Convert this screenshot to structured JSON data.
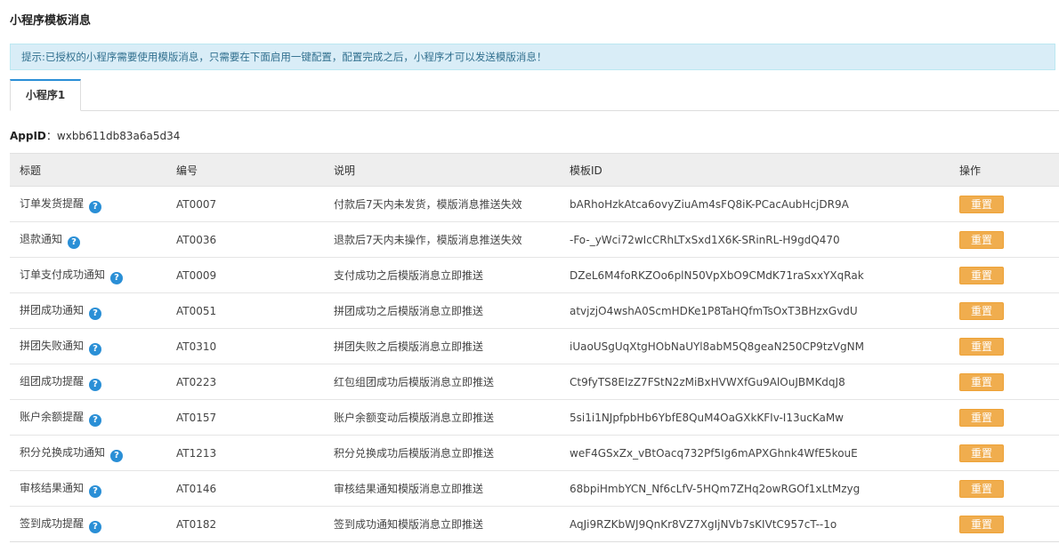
{
  "page_title": "小程序模板消息",
  "notice": "提示:已授权的小程序需要使用模版消息，只需要在下面启用一键配置，配置完成之后，小程序才可以发送模版消息！",
  "tabs": [
    {
      "label": "小程序1"
    }
  ],
  "appid": {
    "label": "AppID",
    "separator": "：",
    "value": "wxbb611db83a6a5d34"
  },
  "table": {
    "headers": [
      "标题",
      "编号",
      "说明",
      "模板ID",
      "操作"
    ],
    "help_icon": "?",
    "action_label": "重置",
    "rows": [
      {
        "title": "订单发货提醒",
        "code": "AT0007",
        "desc": "付款后7天内未发货，模版消息推送失效",
        "template_id": "bARhoHzkAtca6ovyZiuAm4sFQ8iK-PCacAubHcjDR9A"
      },
      {
        "title": "退款通知",
        "code": "AT0036",
        "desc": "退款后7天内未操作，模版消息推送失效",
        "template_id": "-Fo-_yWci72wIcCRhLTxSxd1X6K-SRinRL-H9gdQ470"
      },
      {
        "title": "订单支付成功通知",
        "code": "AT0009",
        "desc": "支付成功之后模版消息立即推送",
        "template_id": "DZeL6M4foRKZOo6plN50VpXbO9CMdK71raSxxYXqRak"
      },
      {
        "title": "拼团成功通知",
        "code": "AT0051",
        "desc": "拼团成功之后模版消息立即推送",
        "template_id": "atvjzjO4wshA0ScmHDKe1P8TaHQfmTsOxT3BHzxGvdU"
      },
      {
        "title": "拼团失败通知",
        "code": "AT0310",
        "desc": "拼团失败之后模版消息立即推送",
        "template_id": "iUaoUSgUqXtgHObNaUYl8abM5Q8geaN250CP9tzVgNM"
      },
      {
        "title": "组团成功提醒",
        "code": "AT0223",
        "desc": "红包组团成功后模版消息立即推送",
        "template_id": "Ct9fyTS8EIzZ7FStN2zMiBxHVWXfGu9AlOuJBMKdqJ8"
      },
      {
        "title": "账户余额提醒",
        "code": "AT0157",
        "desc": "账户余额变动后模版消息立即推送",
        "template_id": "5si1i1NJpfpbHb6YbfE8QuM4OaGXkKFIv-I13ucKaMw"
      },
      {
        "title": "积分兑换成功通知",
        "code": "AT1213",
        "desc": "积分兑换成功后模版消息立即推送",
        "template_id": "weF4GSxZx_vBtOacq732Pf5Ig6mAPXGhnk4WfE5kouE"
      },
      {
        "title": "审核结果通知",
        "code": "AT0146",
        "desc": "审核结果通知模版消息立即推送",
        "template_id": "68bpiHmbYCN_Nf6cLfV-5HQm7ZHq2owRGOf1xLtMzyg"
      },
      {
        "title": "签到成功提醒",
        "code": "AT0182",
        "desc": "签到成功通知模版消息立即推送",
        "template_id": "AqJi9RZKbWJ9QnKr8VZ7XgIjNVb7sKIVtC957cT--1o"
      }
    ]
  },
  "colors": {
    "accent": "#2a8fd6",
    "notice_bg": "#d9edf7",
    "notice_text": "#31708f",
    "button": "#f0ad4e",
    "header_bg": "#eeeeee"
  },
  "icons": {
    "help": "question-circle-icon"
  }
}
